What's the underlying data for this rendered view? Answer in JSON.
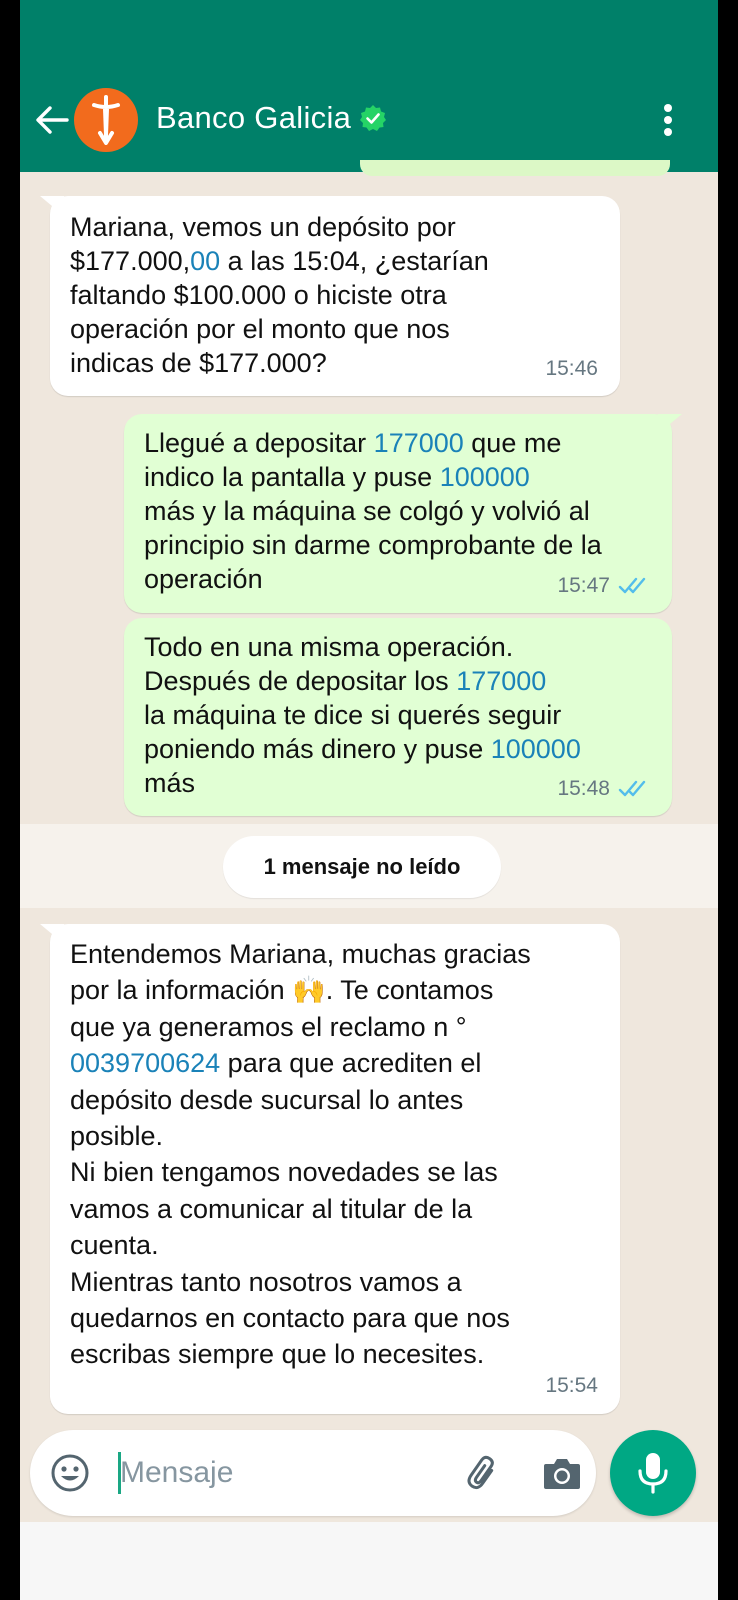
{
  "header": {
    "contact_name": "Banco Galicia",
    "verified": true,
    "accent_color": "#008069",
    "logo_color": "#f26b1d"
  },
  "messages": [
    {
      "direction": "incoming",
      "time": "15:46",
      "parts": [
        {
          "t": "Mariana, vemos un depósito por\n$177.000,"
        },
        {
          "t": "00",
          "link": true
        },
        {
          "t": " a las 15:04, ¿estarían\nfaltando $100.000 o hiciste otra\noperación por el monto que nos\nindicas de $177.000?"
        }
      ]
    },
    {
      "direction": "outgoing",
      "time": "15:47",
      "status": "read",
      "parts": [
        {
          "t": "Llegué a depositar "
        },
        {
          "t": "177000",
          "link": true
        },
        {
          "t": " que me\nindico la pantalla y puse "
        },
        {
          "t": "100000",
          "link": true
        },
        {
          "t": "\nmás y la máquina se colgó y volvió al\nprincipio sin darme comprobante de la\noperación"
        }
      ]
    },
    {
      "direction": "outgoing",
      "time": "15:48",
      "status": "read",
      "parts": [
        {
          "t": "Todo en una misma operación.\nDespués de depositar los "
        },
        {
          "t": "177000",
          "link": true
        },
        {
          "t": "\nla máquina te dice si querés seguir\nponiendo más dinero y puse "
        },
        {
          "t": "100000",
          "link": true
        },
        {
          "t": "\nmás"
        }
      ]
    },
    {
      "direction": "incoming",
      "time": "15:54",
      "parts": [
        {
          "t": "Entendemos Mariana, muchas gracias\npor la información "
        },
        {
          "t": "🙌",
          "emoji": true
        },
        {
          "t": ". Te contamos\nque ya generamos el reclamo n °\n"
        },
        {
          "t": "0039700624",
          "link": true
        },
        {
          "t": " para que acrediten el\ndepósito desde sucursal lo antes\nposible.\nNi bien tengamos novedades se las\nvamos a comunicar al titular de la\ncuenta.\nMientras tanto nosotros vamos a\nquedarnos en contacto para que nos\nescribas siempre que lo necesites."
        }
      ]
    }
  ],
  "unread_label": "1 mensaje no leído",
  "composer": {
    "placeholder": "Mensaje"
  },
  "icons": {
    "back": "arrow-left-icon",
    "menu": "more-vert-icon",
    "emoji": "emoji-icon",
    "attach": "paperclip-icon",
    "camera": "camera-icon",
    "mic": "mic-icon"
  }
}
